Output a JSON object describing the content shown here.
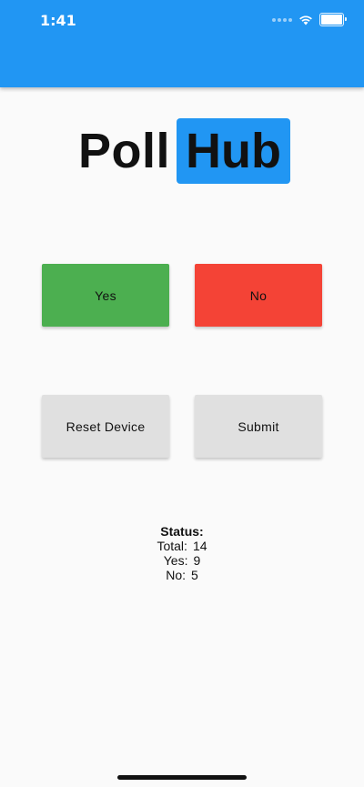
{
  "status_bar": {
    "time": "1:41"
  },
  "logo": {
    "part1": "Poll",
    "part2": "Hub"
  },
  "buttons": {
    "yes": "Yes",
    "no": "No",
    "reset": "Reset Device",
    "submit": "Submit"
  },
  "status": {
    "title": "Status:",
    "total_label": "Total:",
    "total_value": "14",
    "yes_label": "Yes:",
    "yes_value": "9",
    "no_label": "No:",
    "no_value": "5"
  },
  "colors": {
    "app_bar": "#2196f3",
    "yes_button": "#4caf50",
    "no_button": "#f44336",
    "neutral_button": "#e0e0e0",
    "logo_highlight": "#2196f3"
  },
  "icons": {
    "signal": "signal-dots-icon",
    "wifi": "wifi-icon",
    "battery": "battery-icon"
  }
}
